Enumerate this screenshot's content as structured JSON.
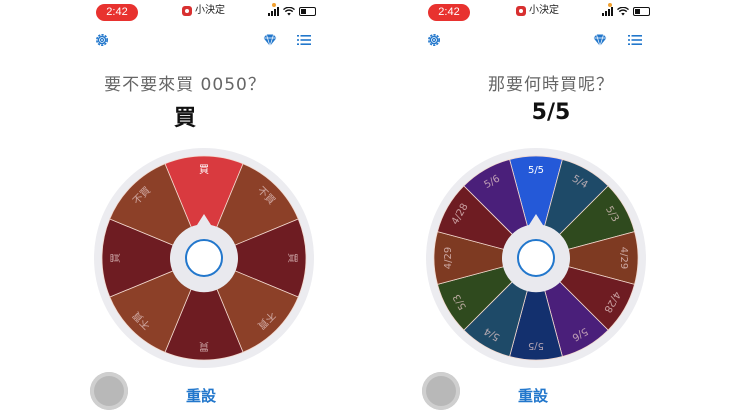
{
  "status_bar": {
    "time": "2:42",
    "app_name": "小決定"
  },
  "colors": {
    "accent": "#2277cc",
    "time_pill": "#e8322f"
  },
  "icons": {
    "settings": "gear-icon",
    "premium": "diamond-icon",
    "list": "list-icon"
  },
  "screens": [
    {
      "question": "要不要來買 0050？",
      "answer": "買",
      "reset_label": "重設",
      "wheel": {
        "selected_index": 0,
        "slices": [
          {
            "label": "買",
            "color": "#d93a3f"
          },
          {
            "label": "不買",
            "color": "#8c4028"
          },
          {
            "label": "買",
            "color": "#6e1c22"
          },
          {
            "label": "不買",
            "color": "#8c4028"
          },
          {
            "label": "買",
            "color": "#6e1c22"
          },
          {
            "label": "不買",
            "color": "#8c4028"
          },
          {
            "label": "買",
            "color": "#6e1c22"
          },
          {
            "label": "不買",
            "color": "#8c4028"
          }
        ]
      }
    },
    {
      "question": "那要何時買呢？",
      "answer": "5/5",
      "reset_label": "重設",
      "wheel": {
        "selected_index": 0,
        "slices": [
          {
            "label": "5/5",
            "color": "#2459d8"
          },
          {
            "label": "5/4",
            "color": "#1e4a68"
          },
          {
            "label": "5/3",
            "color": "#2f4a1e"
          },
          {
            "label": "4/29",
            "color": "#7e3a22"
          },
          {
            "label": "4/28",
            "color": "#6e1c22"
          },
          {
            "label": "5/6",
            "color": "#4a1f7a"
          },
          {
            "label": "5/5",
            "color": "#13306e"
          },
          {
            "label": "5/4",
            "color": "#1e4a68"
          },
          {
            "label": "5/3",
            "color": "#2f4a1e"
          },
          {
            "label": "4/29",
            "color": "#7e3a22"
          },
          {
            "label": "4/28",
            "color": "#6e1c22"
          },
          {
            "label": "5/6",
            "color": "#4a1f7a"
          }
        ]
      }
    }
  ]
}
